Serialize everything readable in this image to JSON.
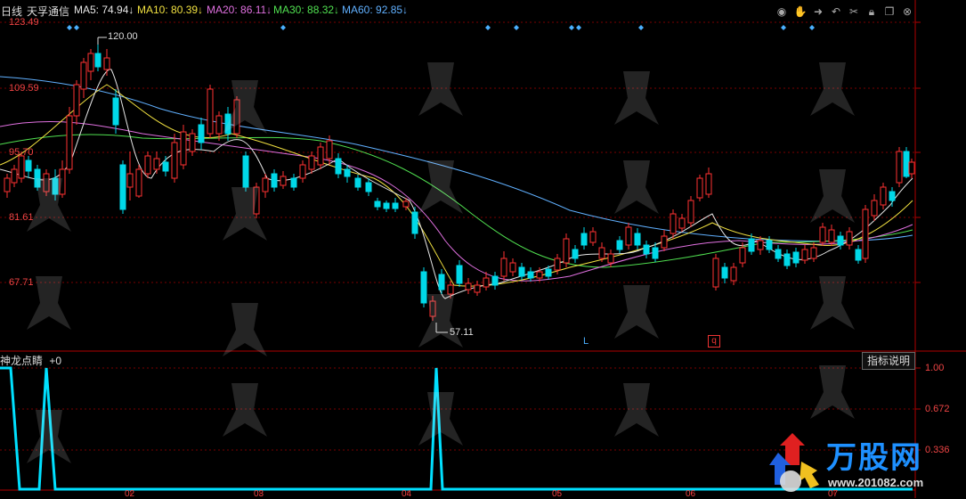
{
  "header": {
    "period": "日线",
    "stock_name": "天孚通信",
    "ma": [
      {
        "label": "MA5: 74.94↓",
        "color": "#e6e6e6"
      },
      {
        "label": "MA10: 80.39↓",
        "color": "#f0e040"
      },
      {
        "label": "MA20: 86.11↓",
        "color": "#e070e0"
      },
      {
        "label": "MA30: 88.32↓",
        "color": "#50e050"
      },
      {
        "label": "MA60: 92.85↓",
        "color": "#60b0ff"
      }
    ]
  },
  "toolbar": {
    "icons": [
      "eye-icon",
      "hand-icon",
      "arrow-right-icon",
      "undo-icon",
      "scissors-icon",
      "lock-icon",
      "restore-icon",
      "close-icon"
    ]
  },
  "price_axis": {
    "labels": [
      "123.49",
      "109.59",
      "95.70",
      "81.61",
      "67.71"
    ]
  },
  "annotations": {
    "high": "120.00",
    "low": "57.11",
    "marker_l": "L",
    "marker_q": "q"
  },
  "indicator": {
    "name": "神龙点睛",
    "value": "+0",
    "help_button": "指标说明",
    "axis_labels": [
      "1.00",
      "0.672",
      "0.336"
    ]
  },
  "time_axis": {
    "labels": [
      "02",
      "03",
      "04",
      "05",
      "06",
      "07"
    ]
  },
  "logo": {
    "brand": "万股网",
    "url": "www.201082.com"
  },
  "colors": {
    "up": "#ff3232",
    "down": "#00d8e8",
    "grid": "#7a0000",
    "axis": "#b00000",
    "indicator": "#00e0ff"
  }
}
